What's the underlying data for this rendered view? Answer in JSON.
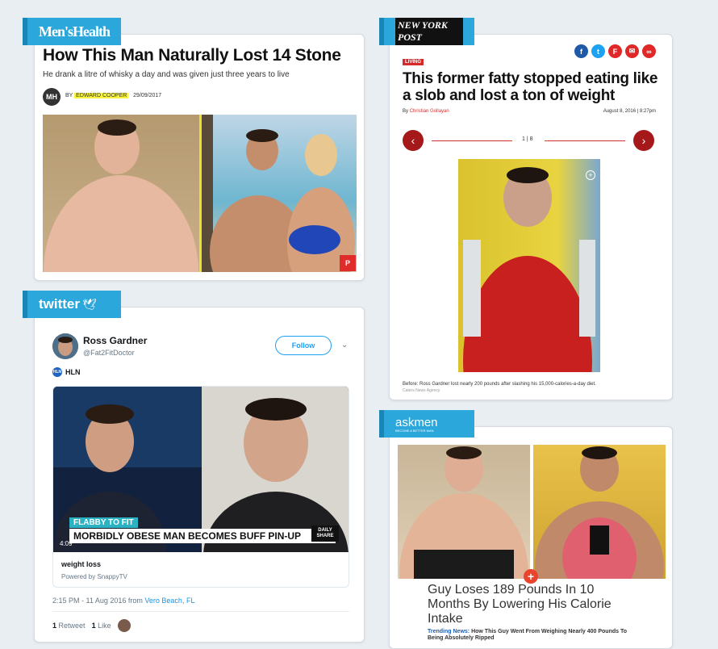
{
  "menshealth": {
    "brand": "Men'sHealth",
    "title": "How This Man Naturally Lost 14 Stone",
    "subtitle": "He drank a litre of whisky a day and was given just three years to live",
    "logo_text": "MH",
    "by": "BY",
    "author": "EDWARD COOPER",
    "date": "29/09/2017",
    "pin_icon": "pinterest-icon"
  },
  "nypost": {
    "brand": "NEW YORK POST",
    "section_tag": "LIVING",
    "title": "This former fatty stopped eating like a slob and lost a ton of weight",
    "byline_prefix": "By",
    "author": "Christian Gollayan",
    "date": "August 8, 2016 | 8:27pm",
    "gallery_count": "1 | 8",
    "caption": "Before: Ross Gardner lost nearly 200 pounds after slashing his 15,000-calories-a-day diet.",
    "credit": "Caters News Agency",
    "share_icons": [
      "facebook-icon",
      "twitter-icon",
      "flipboard-icon",
      "email-icon",
      "link-icon"
    ],
    "share_colors": [
      "#1e5aa8",
      "#1da1f2",
      "#e12828",
      "#e12828",
      "#e12828"
    ]
  },
  "twitter": {
    "brand": "twitter",
    "name": "Ross Gardner",
    "handle": "@Fat2FitDoctor",
    "follow_label": "Follow",
    "source_logo": "HLN",
    "source_name": "HLN",
    "chyron_top": "FLABBY TO FIT",
    "chyron_main": "MORBIDLY OBESE MAN BECOMES BUFF PIN-UP",
    "chyron_logo": "DAILY SHARE",
    "video_time": "4:09",
    "media_title": "weight loss",
    "media_sub": "Powered by SnappyTV",
    "timestamp": "2:15 PM - 11 Aug 2016 from ",
    "location": "Vero Beach, FL",
    "retweets": "1",
    "retweet_label": "Retweet",
    "likes": "1",
    "like_label": "Like"
  },
  "askmen": {
    "brand": "askmen",
    "tagline": "BECOME A BETTER MAN",
    "title": "Guy Loses 189 Pounds In 10 Months By Lowering His Calorie Intake",
    "trending_label": "Trending News:",
    "trending_text": "How This Guy Went From Weighing Nearly 400 Pounds To Being Absolutely Ripped"
  }
}
